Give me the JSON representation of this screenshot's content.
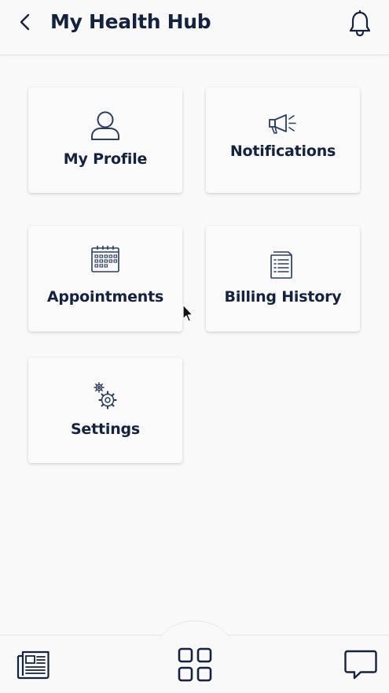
{
  "header": {
    "title": "My Health Hub"
  },
  "cards": [
    {
      "label": "My Profile",
      "icon": "user-icon"
    },
    {
      "label": "Notifications",
      "icon": "megaphone-icon"
    },
    {
      "label": "Appointments",
      "icon": "calendar-icon"
    },
    {
      "label": "Billing History",
      "icon": "document-icon"
    },
    {
      "label": "Settings",
      "icon": "gears-icon"
    }
  ],
  "bottom_nav": [
    {
      "icon": "newspaper-icon"
    },
    {
      "icon": "grid-icon"
    },
    {
      "icon": "chat-icon"
    }
  ],
  "colors": {
    "text_primary": "#14223d",
    "background": "#f9f9fa",
    "card_bg": "#fafafb"
  }
}
